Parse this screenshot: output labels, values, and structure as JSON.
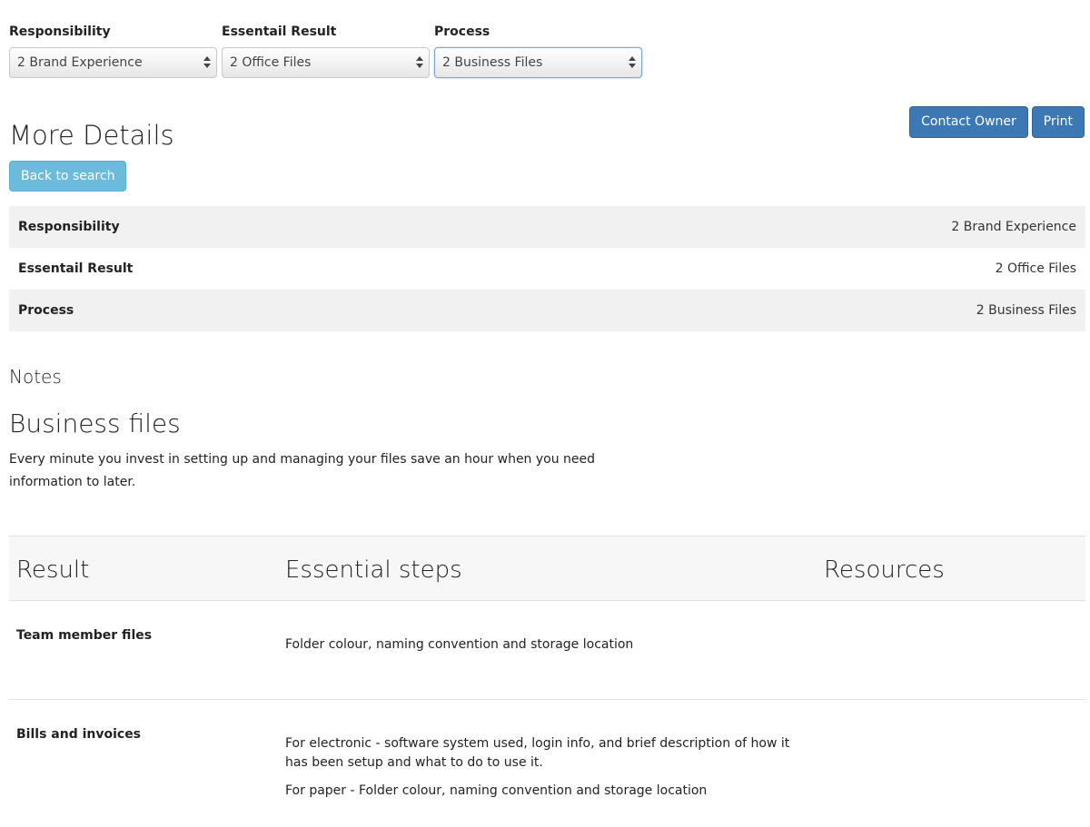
{
  "filters": [
    {
      "label": "Responsibility",
      "value": "2 Brand Experience"
    },
    {
      "label": "Essentail Result",
      "value": "2 Office Files"
    },
    {
      "label": "Process",
      "value": "2 Business Files"
    }
  ],
  "actions": {
    "contact_owner": "Contact Owner",
    "print": "Print"
  },
  "page_title": "More Details",
  "back_button": "Back to search",
  "details": [
    {
      "key": "Responsibility",
      "value": "2 Brand Experience"
    },
    {
      "key": "Essentail Result",
      "value": "2 Office Files"
    },
    {
      "key": "Process",
      "value": "2 Business Files"
    }
  ],
  "notes_label": "Notes",
  "section_title": "Business files",
  "intro": "Every minute you invest in setting up and managing your files save an hour when you need information to later.",
  "table": {
    "headers": {
      "result": "Result",
      "steps": "Essential steps",
      "resources": "Resources"
    },
    "rows": [
      {
        "result": "Team member files",
        "steps": [
          "Folder colour, naming convention and storage location"
        ]
      },
      {
        "result": "Bills and invoices",
        "steps": [
          "For electronic - software system used, login info, and brief description of how it has been setup and what to do to use it.",
          "For paper - Folder colour, naming convention and storage location"
        ]
      }
    ]
  }
}
